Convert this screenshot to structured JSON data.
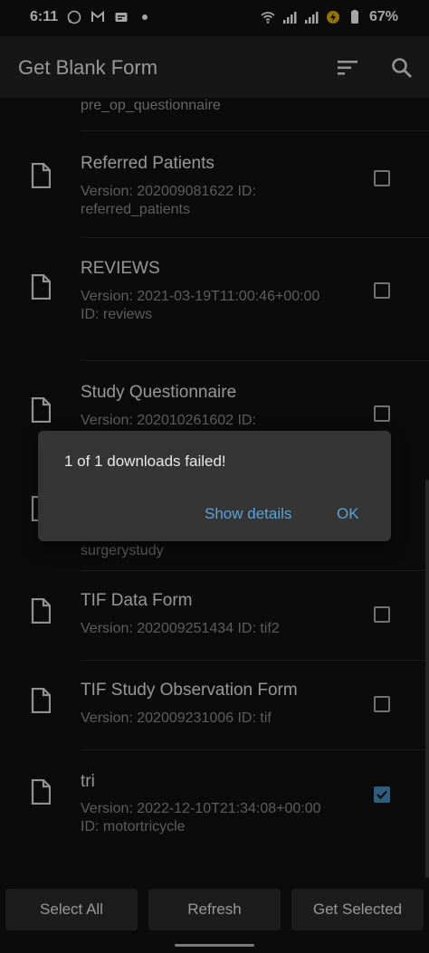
{
  "status_bar": {
    "time": "6:11",
    "battery": "67%"
  },
  "toolbar": {
    "title": "Get Blank Form"
  },
  "list": {
    "partial_top_text": "pre_op_questionnaire",
    "items": [
      {
        "title": "Referred Patients",
        "subtitle": "Version: 202009081622 ID: referred_patients",
        "checked": false
      },
      {
        "title": "REVIEWS",
        "subtitle": "Version: 2021-03-19T11:00:46+00:00 ID: reviews",
        "checked": false
      },
      {
        "title": "Study Questionnaire",
        "subtitle": "Version: 202010261602 ID:",
        "checked": false
      },
      {
        "title": "",
        "subtitle": "surgerystudy",
        "checked": false
      },
      {
        "title": "TIF Data Form",
        "subtitle": "Version: 202009251434 ID: tif2",
        "checked": false
      },
      {
        "title": "TIF Study Observation Form",
        "subtitle": "Version: 202009231006 ID: tif",
        "checked": false
      },
      {
        "title": "tri",
        "subtitle": "Version: 2022-12-10T21:34:08+00:00 ID: motortricycle",
        "checked": true
      }
    ]
  },
  "dialog": {
    "message": "1 of 1 downloads failed!",
    "show_details_label": "Show details",
    "ok_label": "OK"
  },
  "bottom_buttons": {
    "select_all": "Select All",
    "refresh": "Refresh",
    "get_selected": "Get Selected"
  },
  "colors": {
    "accent": "#5aa3d8",
    "checkbox_checked": "#4a90c2"
  }
}
